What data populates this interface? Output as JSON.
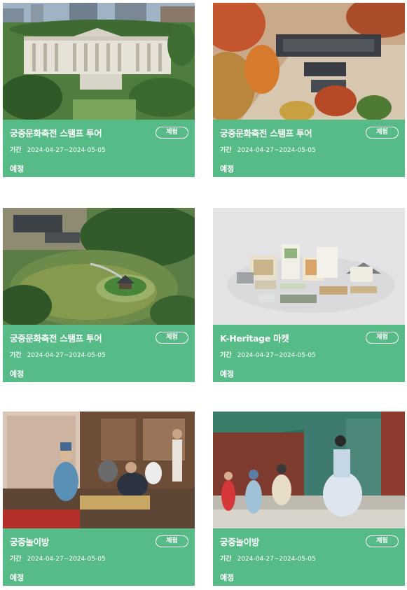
{
  "cards": [
    {
      "title": "궁중문화축전 스탬프 투어",
      "badge": "체험",
      "period_label": "기간",
      "period": "2024-04-27~2024-05-05",
      "status": "예정",
      "image": "palace-hall-aerial"
    },
    {
      "title": "궁중문화축전 스탬프 투어",
      "badge": "체험",
      "period_label": "기간",
      "period": "2024-04-27~2024-05-05",
      "status": "예정",
      "image": "palace-autumn-aerial"
    },
    {
      "title": "궁중문화축전 스탬프 투어",
      "badge": "체험",
      "period_label": "기간",
      "period": "2024-04-27~2024-05-05",
      "status": "예정",
      "image": "palace-pond-aerial"
    },
    {
      "title": "K-Heritage 마켓",
      "badge": "체험",
      "period_label": "기간",
      "period": "2024-04-27~2024-05-05",
      "status": "예정",
      "image": "heritage-goods"
    },
    {
      "title": "궁중놀이방",
      "badge": "체험",
      "period_label": "기간",
      "period": "2024-04-27~2024-05-05",
      "status": "예정",
      "image": "palace-play-room"
    },
    {
      "title": "궁중놀이방",
      "badge": "체험",
      "period_label": "기간",
      "period": "2024-04-27~2024-05-05",
      "status": "예정",
      "image": "hanbok-courtyard"
    }
  ],
  "colors": {
    "card_info_bg": "#57bb88",
    "text": "#ffffff"
  }
}
